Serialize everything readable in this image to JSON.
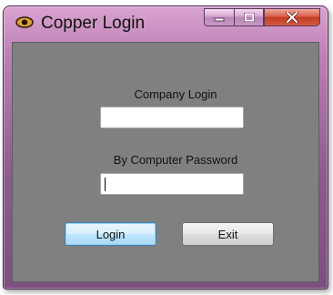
{
  "window": {
    "title": "Copper Login",
    "icon": "copper-eye-icon",
    "caption_buttons": [
      "minimize-icon",
      "maximize-icon",
      "close-icon"
    ]
  },
  "form": {
    "company_label": "Company Login",
    "company_value": "",
    "password_label": "By Computer Password",
    "password_value": ""
  },
  "buttons": {
    "login": "Login",
    "exit": "Exit"
  },
  "colors": {
    "titlebar": "#bb7fb6",
    "client_bg": "#808080",
    "close_button": "#c23c26"
  }
}
